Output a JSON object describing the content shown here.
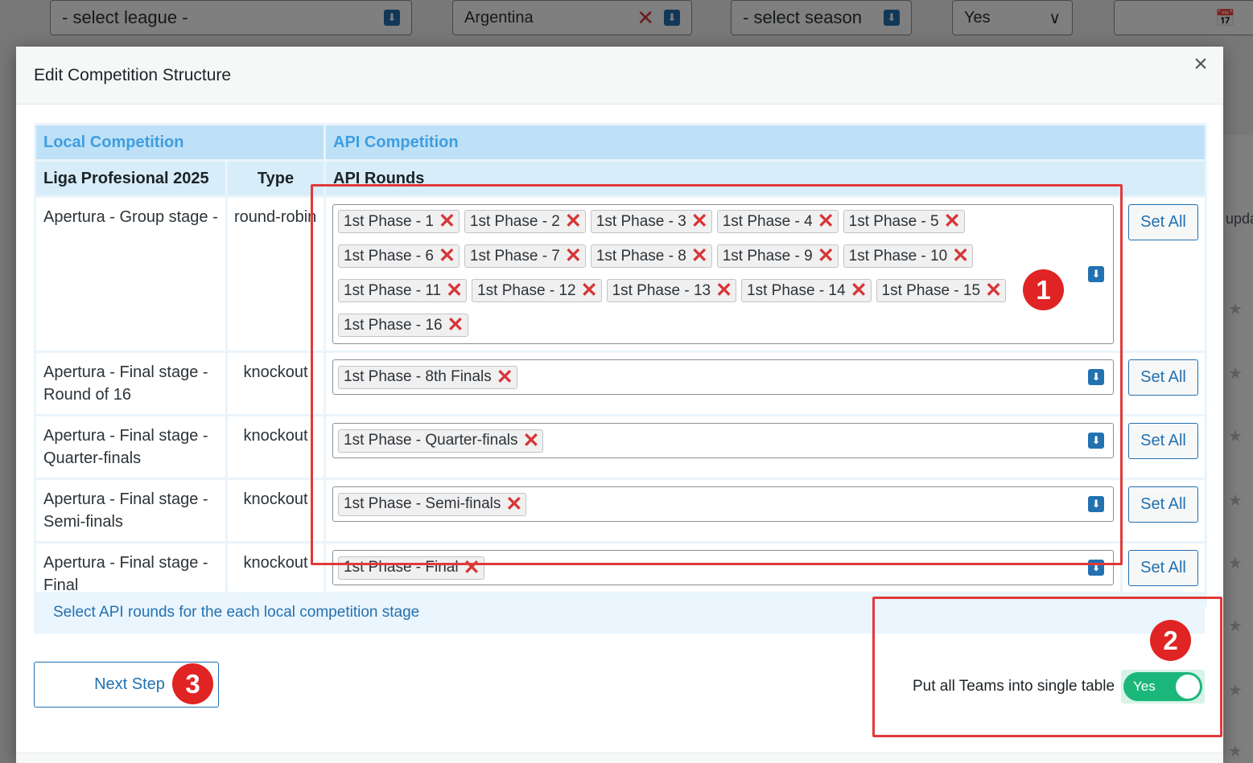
{
  "background": {
    "filters": {
      "league": "- select league -",
      "country": "Argentina",
      "season": "- select season",
      "yes_select": "Yes"
    },
    "side_text": "upda"
  },
  "modal": {
    "title": "Edit Competition Structure",
    "close_icon": "×",
    "table": {
      "header_local": "Local Competition",
      "header_api": "API Competition",
      "col_competition": "Liga Profesional 2025",
      "col_type": "Type",
      "col_rounds": "API Rounds",
      "rows": [
        {
          "stage": "Apertura - Group stage -",
          "type": "round-robin",
          "rounds": [
            "1st Phase - 1",
            "1st Phase - 2",
            "1st Phase - 3",
            "1st Phase - 4",
            "1st Phase - 5",
            "1st Phase - 6",
            "1st Phase - 7",
            "1st Phase - 8",
            "1st Phase - 9",
            "1st Phase - 10",
            "1st Phase - 11",
            "1st Phase - 12",
            "1st Phase - 13",
            "1st Phase - 14",
            "1st Phase - 15",
            "1st Phase - 16"
          ],
          "button": "Set All"
        },
        {
          "stage": "Apertura - Final stage - Round of 16",
          "type": "knockout",
          "rounds": [
            "1st Phase - 8th Finals"
          ],
          "button": "Set All"
        },
        {
          "stage": "Apertura - Final stage - Quarter-finals",
          "type": "knockout",
          "rounds": [
            "1st Phase - Quarter-finals"
          ],
          "button": "Set All"
        },
        {
          "stage": "Apertura - Final stage - Semi-finals",
          "type": "knockout",
          "rounds": [
            "1st Phase - Semi-finals"
          ],
          "button": "Set All"
        },
        {
          "stage": "Apertura - Final stage - Final",
          "type": "knockout",
          "rounds": [
            "1st Phase - Final"
          ],
          "button": "Set All"
        }
      ]
    },
    "info_text": "Select API rounds for the each local competition stage",
    "next_button": "Next Step",
    "single_table": {
      "label": "Put all Teams into single table",
      "toggle_label": "Yes",
      "enabled": true
    }
  },
  "annotations": [
    "1",
    "2",
    "3"
  ],
  "colors": {
    "accent": "#2271b1",
    "header_blue": "#3e9ee0",
    "remove": "#d63638",
    "toggle_on": "#1bb67a",
    "annotation": "#e02424"
  }
}
